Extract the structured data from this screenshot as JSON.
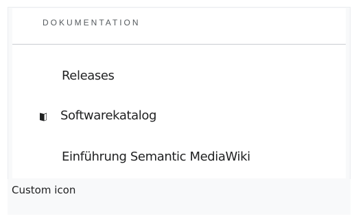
{
  "nav": {
    "heading": "DOKUMENTATION",
    "items": [
      {
        "label": "Releases",
        "icon": null
      },
      {
        "label": "Softwarekatalog",
        "icon": "book-icon"
      },
      {
        "label": "Einführung Semantic MediaWiki",
        "icon": null
      }
    ]
  },
  "caption": "Custom icon",
  "colors": {
    "heading": "#54595d",
    "text": "#202122",
    "divider": "#c8ccd1",
    "frame_bg": "#f8f9fa"
  }
}
